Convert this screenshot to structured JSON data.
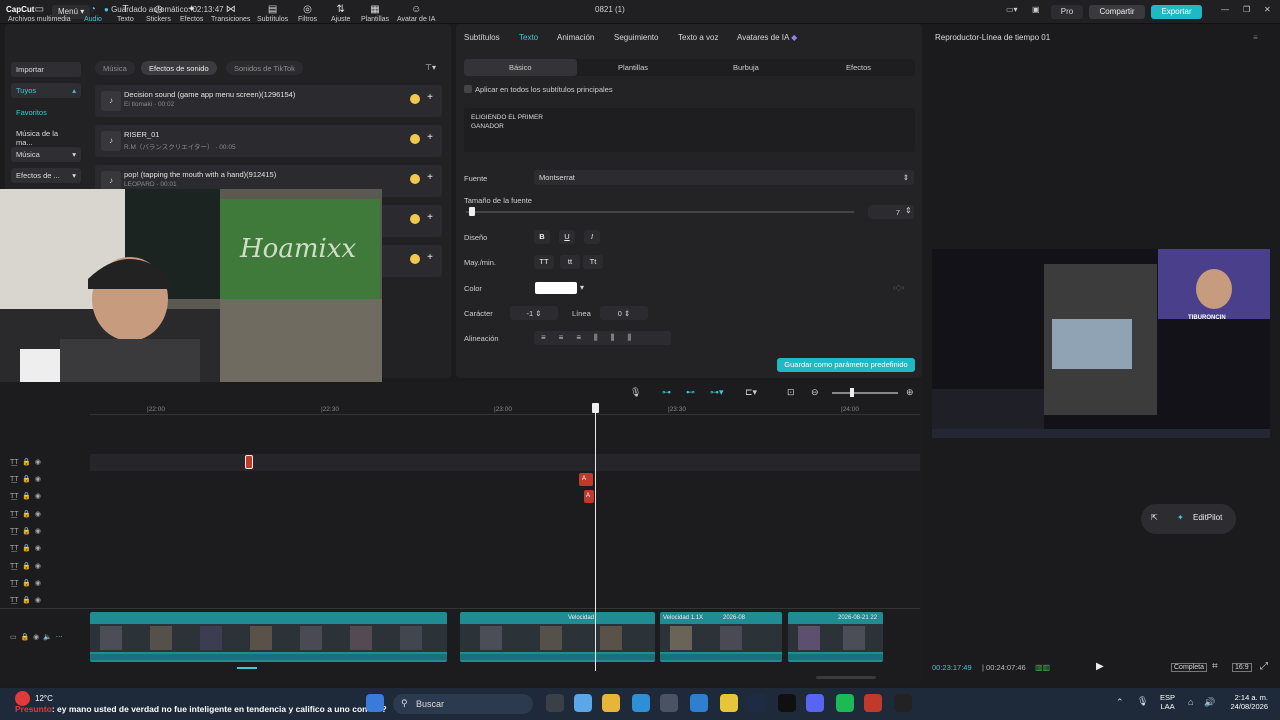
{
  "titlebar": {
    "app_logo": "CapCut",
    "menu": "Menú",
    "autosave": "Guardado automático: 02:13:47",
    "project_title": "0821 (1)",
    "pro": "Pro",
    "share": "Compartir",
    "export": "Exportar"
  },
  "toolbar": {
    "tools": [
      {
        "label": "Archivos multimedia",
        "icon": "media-icon"
      },
      {
        "label": "Audio",
        "icon": "audio-icon"
      },
      {
        "label": "Texto",
        "icon": "text-icon"
      },
      {
        "label": "Stickers",
        "icon": "sticker-icon"
      },
      {
        "label": "Efectos",
        "icon": "effects-icon"
      },
      {
        "label": "Transiciones",
        "icon": "transitions-icon"
      },
      {
        "label": "Subtítulos",
        "icon": "subtitles-icon"
      },
      {
        "label": "Filtros",
        "icon": "filters-icon"
      },
      {
        "label": "Ajuste",
        "icon": "adjust-icon"
      },
      {
        "label": "Plantillas",
        "icon": "templates-icon"
      },
      {
        "label": "Avatar de IA",
        "icon": "ai-avatar-icon"
      }
    ]
  },
  "sidebar": {
    "items": [
      "Importar",
      "Tuyos",
      "Favoritos",
      "Música de la ma...",
      "Música",
      "Efectos de ..."
    ]
  },
  "audio_tabs": [
    "Música",
    "Efectos de sonido",
    "Sonidos de TikTok"
  ],
  "sounds": [
    {
      "title": "Decision sound (game app menu screen)(1296154)",
      "meta": "Ei tlomaki · 00:02"
    },
    {
      "title": "RISER_01",
      "meta": "R.M（バランスクリエイター） · 00:05"
    },
    {
      "title": "pop! (tapping the mouth with a hand)(912415)",
      "meta": "LEOPARD · 00:01"
    }
  ],
  "inspector": {
    "tabs": [
      "Subtítulos",
      "Texto",
      "Animación",
      "Seguimiento",
      "Texto a voz",
      "Avatares de IA"
    ],
    "subtabs": [
      "Básico",
      "Plantillas",
      "Burbuja",
      "Efectos"
    ],
    "apply_all": "Aplicar en todos los subtítulos principales",
    "text_content": "ELIGIENDO EL PRIMER\nGANADOR",
    "font_label": "Fuente",
    "font_value": "Montserrat",
    "size_label": "Tamaño de la fuente",
    "size_value": "7",
    "size_fraction": 0.01,
    "design_label": "Diseño",
    "design_buttons": [
      "B",
      "U",
      "I"
    ],
    "case_label": "May./min.",
    "case_buttons": [
      "TT",
      "tt",
      "Tt"
    ],
    "color_label": "Color",
    "color_value": "#ffffff",
    "char_label": "Carácter",
    "char_value": "-1",
    "line_label": "Línea",
    "line_value": "0",
    "align_label": "Alineación",
    "save_default": "Guardar como parámetro predefinido"
  },
  "player": {
    "title": "Reproductor-Línea de tiempo 01",
    "current_time": "00:23:17:49",
    "total_time": "00:24:07:46",
    "full": "Completa",
    "ratio": "16:9",
    "editpilot": "EditPilot",
    "preview_watermark": "TIBURONCIN"
  },
  "timeline": {
    "ruler": [
      "|22:00",
      "|22:30",
      "|23:00",
      "|23:30",
      "|24:00"
    ],
    "clip_labels": [
      "Velocidad 1.1X",
      "2026-08",
      "Velocidad",
      "2026-08-21 22"
    ],
    "text_clip": "A"
  },
  "webcam": {
    "sign": "Hoamixx"
  },
  "taskbar": {
    "weather": "12°C",
    "search": "Buscar",
    "ticker_user": "Presunto",
    "ticker_text": ": ey mano usted de verdad no fue inteligente en tendencia y califico a uno con 6.7?",
    "lang": "ESP",
    "lang2": "LAA",
    "time": "2:14 a. m.",
    "date": "24/08/2026"
  },
  "colors": {
    "accent": "#3ec9d6",
    "export": "#1fb9c6",
    "clip": "#1f8c94",
    "text_clip": "#c0392b"
  }
}
